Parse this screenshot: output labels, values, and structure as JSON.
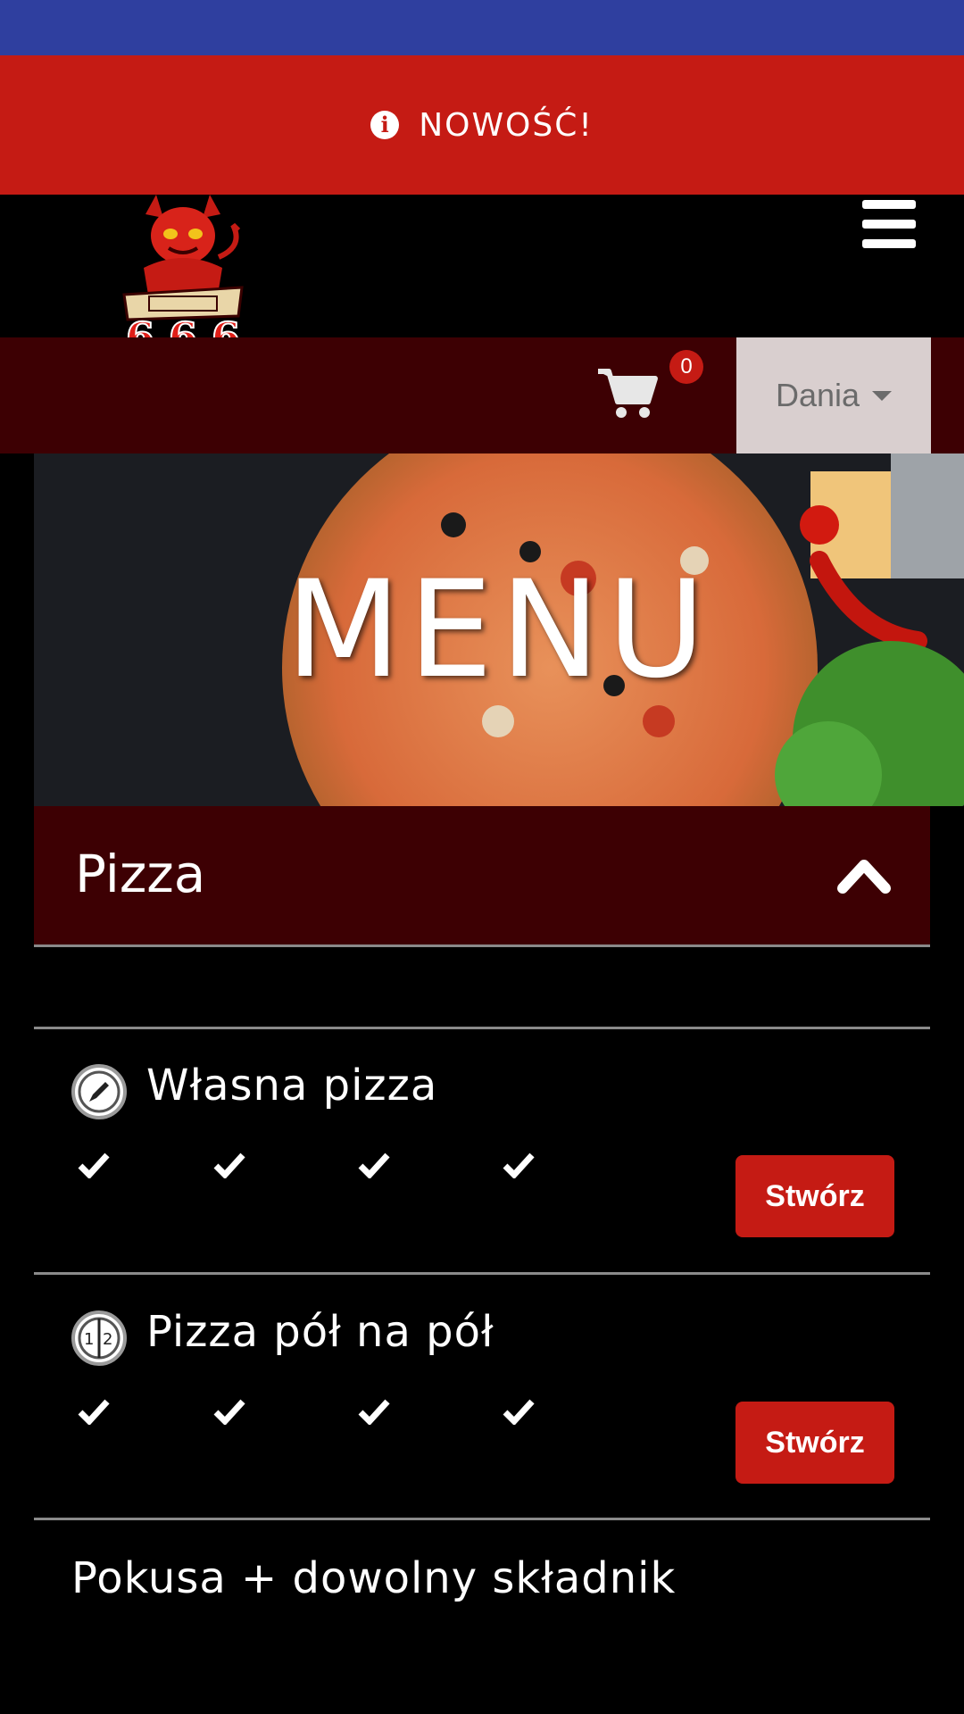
{
  "news_bar": {
    "icon": "info-circle-icon",
    "label": "NOWOŚĆ!"
  },
  "header": {
    "menu_icon": "hamburger-icon",
    "logo_icon": "devil-pizzeria-logo"
  },
  "toolbar": {
    "cart_icon": "cart-icon",
    "cart_count": "0",
    "category_label": "Dania"
  },
  "hero": {
    "title": "MENU"
  },
  "section": {
    "title": "Pizza",
    "items": [
      {
        "title": "Własna pizza",
        "icon": "pencil-icon",
        "button": "Stwórz"
      },
      {
        "title": "Pizza pół na pół",
        "icon": "half-half-icon",
        "button": "Stwórz"
      },
      {
        "title": "Pokusa + dowolny składnik"
      }
    ]
  },
  "colors": {
    "status_bar": "#2f3f9f",
    "news_bar": "#c51b14",
    "toolbar": "#3d0003",
    "button": "#c51b14",
    "dropdown_bg": "#d9cfcf"
  }
}
